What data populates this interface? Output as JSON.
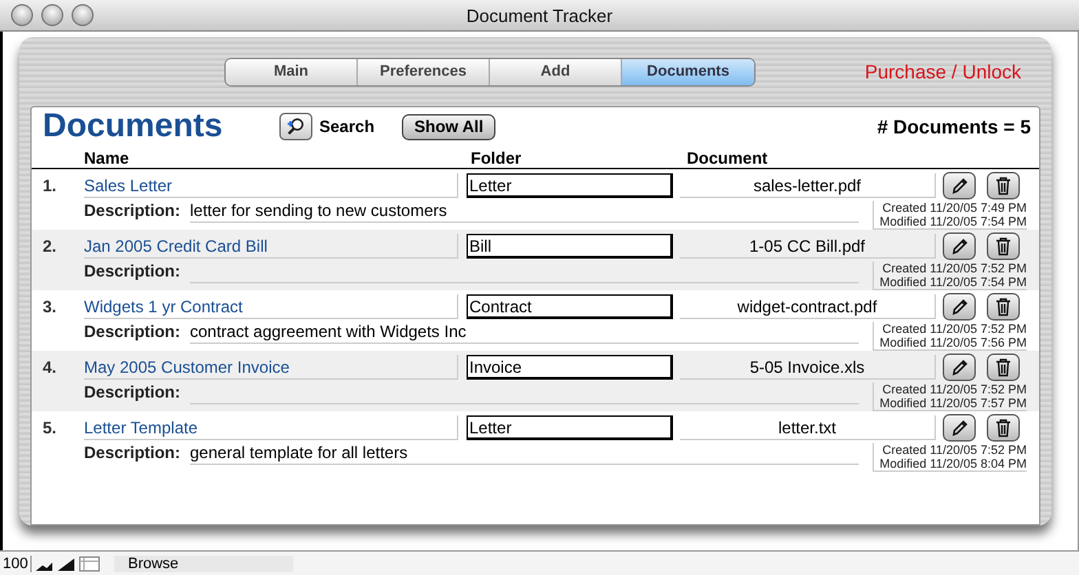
{
  "window": {
    "title": "Document Tracker"
  },
  "tabs": [
    {
      "label": "Main",
      "selected": false
    },
    {
      "label": "Preferences",
      "selected": false
    },
    {
      "label": "Add",
      "selected": false
    },
    {
      "label": "Documents",
      "selected": true
    }
  ],
  "purchase_link": "Purchase / Unlock",
  "panel": {
    "title": "Documents",
    "search_label": "Search",
    "show_all": "Show All",
    "count": "# Documents = 5"
  },
  "columns": [
    "Name",
    "Folder",
    "Document"
  ],
  "rows": [
    {
      "number": "1.",
      "name": "Sales Letter",
      "folder": "Letter",
      "document": "sales-letter.pdf",
      "description_label": "Description:",
      "description": "letter for sending to new customers",
      "created": "Created 11/20/05 7:49 PM",
      "modified": "Modified 11/20/05 7:54 PM"
    },
    {
      "number": "2.",
      "name": "Jan 2005 Credit Card Bill",
      "folder": "Bill",
      "document": "1-05 CC Bill.pdf",
      "description_label": "Description:",
      "created": "Created 11/20/05 7:52 PM",
      "modified": "Modified 11/20/05 7:54 PM"
    },
    {
      "number": "3.",
      "name": "Widgets 1 yr Contract",
      "folder": "Contract",
      "document": "widget-contract.pdf",
      "description_label": "Description:",
      "description": "contract aggreement with Widgets Inc",
      "created": "Created 11/20/05 7:52 PM",
      "modified": "Modified 11/20/05 7:56 PM"
    },
    {
      "number": "4.",
      "name": "May 2005 Customer Invoice",
      "folder": "Invoice",
      "document": "5-05 Invoice.xls",
      "description_label": "Description:",
      "created": "Created 11/20/05 7:52 PM",
      "modified": "Modified 11/20/05 7:57 PM"
    },
    {
      "number": "5.",
      "name": "Letter Template",
      "folder": "Letter",
      "document": "letter.txt",
      "description_label": "Description:",
      "description": "general template for all letters",
      "created": "Created 11/20/05 7:52 PM",
      "modified": "Modified 11/20/05 8:04 PM"
    }
  ],
  "status_bar": {
    "zoom": "100",
    "mode": "Browse"
  }
}
